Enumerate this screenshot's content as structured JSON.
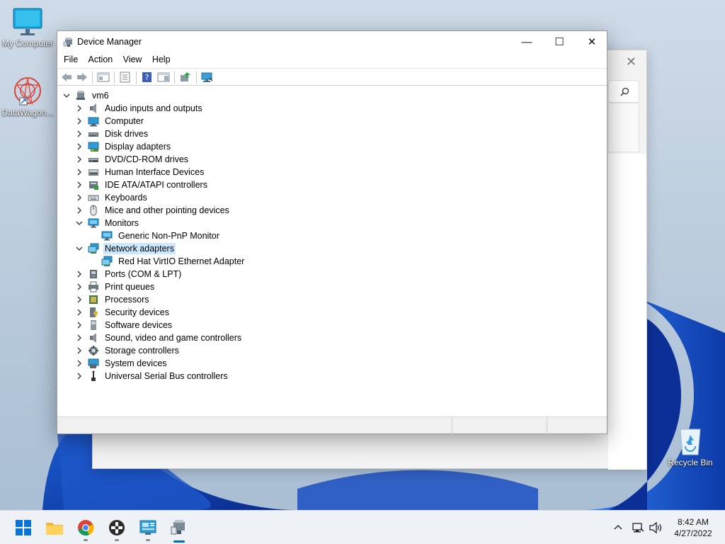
{
  "desktop": {
    "icons": [
      {
        "label": "My Computer"
      },
      {
        "label": "DataWagon..."
      },
      {
        "label": "Recycle Bin"
      }
    ]
  },
  "window": {
    "title": "Device Manager",
    "menu": [
      "File",
      "Action",
      "View",
      "Help"
    ],
    "controls": {
      "minimize": "—",
      "maximize": "☐",
      "close": "✕"
    }
  },
  "tree": {
    "root": "vm6",
    "items": [
      {
        "label": "Audio inputs and outputs",
        "icon": "speaker-icon",
        "expanded": false
      },
      {
        "label": "Computer",
        "icon": "computer-icon",
        "expanded": false
      },
      {
        "label": "Disk drives",
        "icon": "disk-icon",
        "expanded": false
      },
      {
        "label": "Display adapters",
        "icon": "display-adapter-icon",
        "expanded": false
      },
      {
        "label": "DVD/CD-ROM drives",
        "icon": "dvd-icon",
        "expanded": false
      },
      {
        "label": "Human Interface Devices",
        "icon": "hid-icon",
        "expanded": false
      },
      {
        "label": "IDE ATA/ATAPI controllers",
        "icon": "ide-icon",
        "expanded": false
      },
      {
        "label": "Keyboards",
        "icon": "keyboard-icon",
        "expanded": false
      },
      {
        "label": "Mice and other pointing devices",
        "icon": "mouse-icon",
        "expanded": false
      },
      {
        "label": "Monitors",
        "icon": "monitor-icon",
        "expanded": true
      },
      {
        "label": "Generic Non-PnP Monitor",
        "icon": "monitor-icon",
        "child": true
      },
      {
        "label": "Network adapters",
        "icon": "network-icon",
        "expanded": true,
        "selected": true
      },
      {
        "label": "Red Hat VirtIO Ethernet Adapter",
        "icon": "network-icon",
        "child": true
      },
      {
        "label": "Ports (COM & LPT)",
        "icon": "port-icon",
        "expanded": false
      },
      {
        "label": "Print queues",
        "icon": "printer-icon",
        "expanded": false
      },
      {
        "label": "Processors",
        "icon": "processor-icon",
        "expanded": false
      },
      {
        "label": "Security devices",
        "icon": "security-icon",
        "expanded": false
      },
      {
        "label": "Software devices",
        "icon": "software-icon",
        "expanded": false
      },
      {
        "label": "Sound, video and game controllers",
        "icon": "speaker-icon",
        "expanded": false
      },
      {
        "label": "Storage controllers",
        "icon": "storage-icon",
        "expanded": false
      },
      {
        "label": "System devices",
        "icon": "system-icon",
        "expanded": false
      },
      {
        "label": "Universal Serial Bus controllers",
        "icon": "usb-icon",
        "expanded": false
      }
    ]
  },
  "taskbar": {
    "time": "8:42 AM",
    "date": "4/27/2022"
  },
  "colors": {
    "selection": "#cce8ff",
    "accent": "#0067c0"
  }
}
